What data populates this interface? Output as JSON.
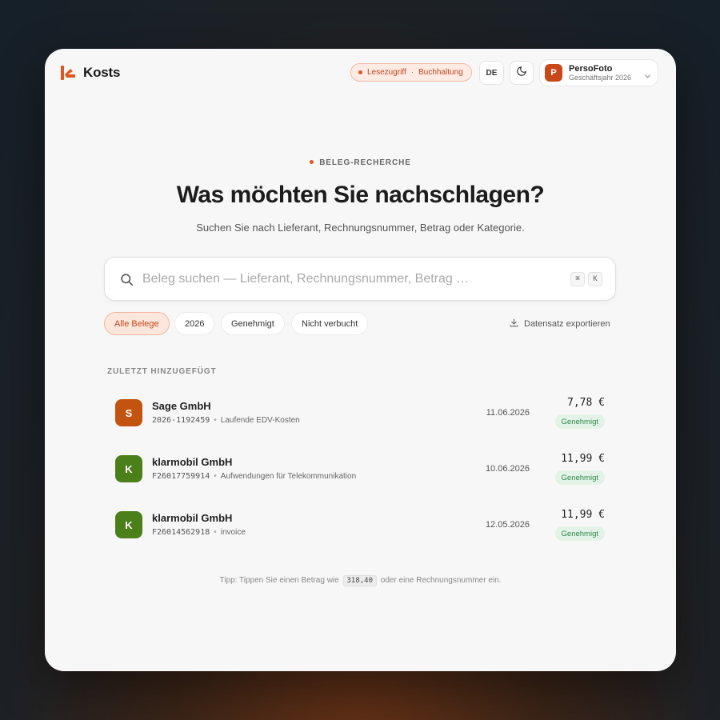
{
  "app": {
    "name": "Kosts",
    "brand_color": "#e2561f"
  },
  "header": {
    "access_badge": {
      "part1": "Lesezugriff",
      "separator": "·",
      "part2": "Buchhaltung"
    },
    "language": "DE",
    "theme_icon": "moon-icon",
    "company": {
      "initial": "P",
      "name": "PersoFoto",
      "subtitle": "Geschäftsjahr 2026"
    }
  },
  "hero": {
    "eyebrow": "BELEG-RECHERCHE",
    "headline": "Was möchten Sie nachschlagen?",
    "subline": "Suchen Sie nach Lieferant, Rechnungsnummer, Betrag oder Kategorie."
  },
  "search": {
    "placeholder": "Beleg suchen — Lieferant, Rechnungsnummer, Betrag …",
    "value": "",
    "shortcut": [
      "⌘",
      "K"
    ]
  },
  "filters": {
    "chips": [
      "Alle Belege",
      "2026",
      "Genehmigt",
      "Nicht verbucht"
    ],
    "active": "Alle Belege",
    "export_label": "Datensatz exportieren"
  },
  "recent": {
    "title": "ZULETZT HINZUGEFÜGT",
    "items": [
      {
        "initial": "S",
        "color": "#c2540f",
        "vendor": "Sage GmbH",
        "number": "2026-1192459",
        "category": "Laufende EDV-Kosten",
        "date": "11.06.2026",
        "amount": "7,78 €",
        "status": "Genehmigt"
      },
      {
        "initial": "K",
        "color": "#4b7f1a",
        "vendor": "klarmobil GmbH",
        "number": "F26017759914",
        "category": "Aufwendungen für Telekommunikation",
        "date": "10.06.2026",
        "amount": "11,99 €",
        "status": "Genehmigt"
      },
      {
        "initial": "K",
        "color": "#4b7f1a",
        "vendor": "klarmobil GmbH",
        "number": "F26014562918",
        "category": "invoice",
        "date": "12.05.2026",
        "amount": "11,99 €",
        "status": "Genehmigt"
      }
    ]
  },
  "tip": {
    "before": "Tipp: Tippen Sie einen Betrag wie",
    "example": "318,40",
    "after": "oder eine Rechnungsnummer ein."
  }
}
